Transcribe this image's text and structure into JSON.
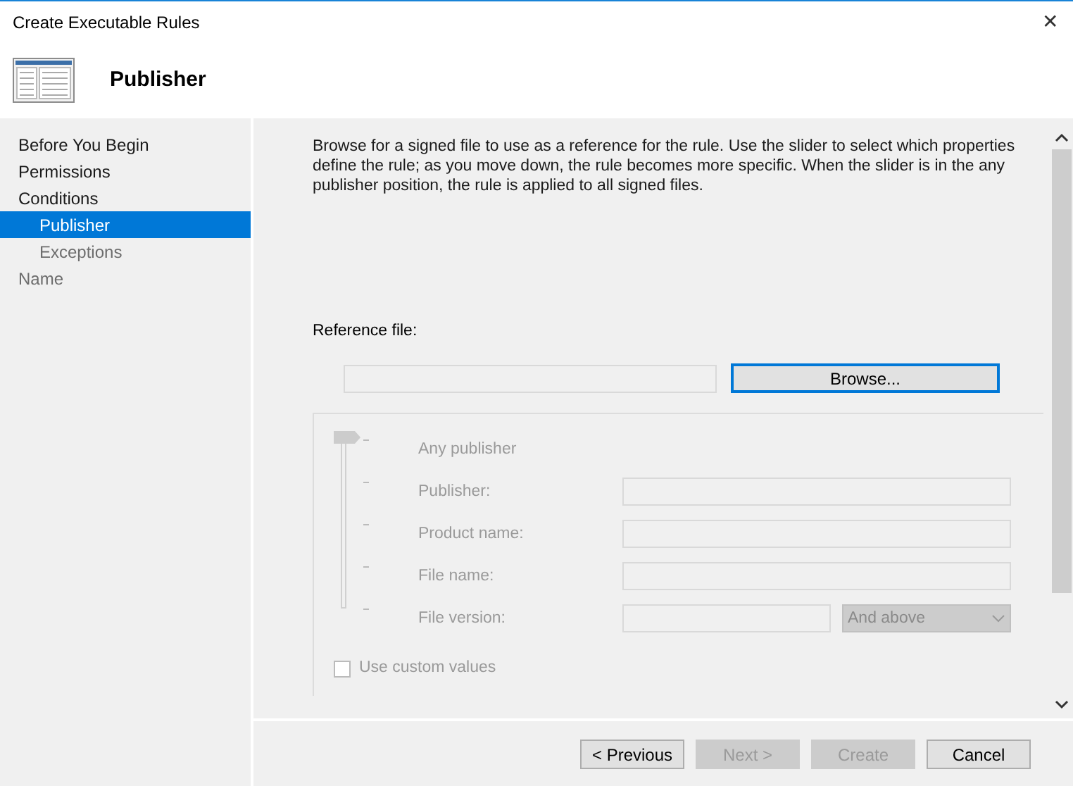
{
  "window": {
    "title": "Create Executable Rules",
    "close": "✕"
  },
  "header": {
    "title": "Publisher"
  },
  "nav": [
    {
      "label": "Before You Begin",
      "selected": false,
      "disabled": false
    },
    {
      "label": "Permissions",
      "selected": false,
      "disabled": false
    },
    {
      "label": "Conditions",
      "selected": false,
      "disabled": false,
      "children": [
        {
          "label": "Publisher",
          "selected": true,
          "disabled": false
        },
        {
          "label": "Exceptions",
          "selected": false,
          "disabled": true
        }
      ]
    },
    {
      "label": "Name",
      "selected": false,
      "disabled": true
    }
  ],
  "description": "Browse for a signed file to use as a reference for the rule. Use the slider to select which properties define the rule; as you move down, the rule becomes more specific. When the slider is in the any publisher position, the rule is applied to all signed files.",
  "reference": {
    "label": "Reference file:",
    "browse": {
      "label": "Browse...",
      "focused": true
    }
  },
  "slider": {
    "level": 0,
    "disabled": true
  },
  "levels": [
    {
      "kind": "plain",
      "label": "Any publisher"
    },
    {
      "kind": "field",
      "label": "Publisher:"
    },
    {
      "kind": "field",
      "label": "Product name:"
    },
    {
      "kind": "field",
      "label": "File name:"
    },
    {
      "kind": "version",
      "label": "File version:",
      "option": "And above"
    }
  ],
  "custom": {
    "label": "Use custom values",
    "checked": false,
    "disabled": true
  },
  "buttons": [
    {
      "label": "< Previous",
      "disabled": false
    },
    {
      "label": "Next >",
      "disabled": true
    },
    {
      "label": "Create",
      "disabled": true
    },
    {
      "label": "Cancel",
      "disabled": false
    }
  ]
}
